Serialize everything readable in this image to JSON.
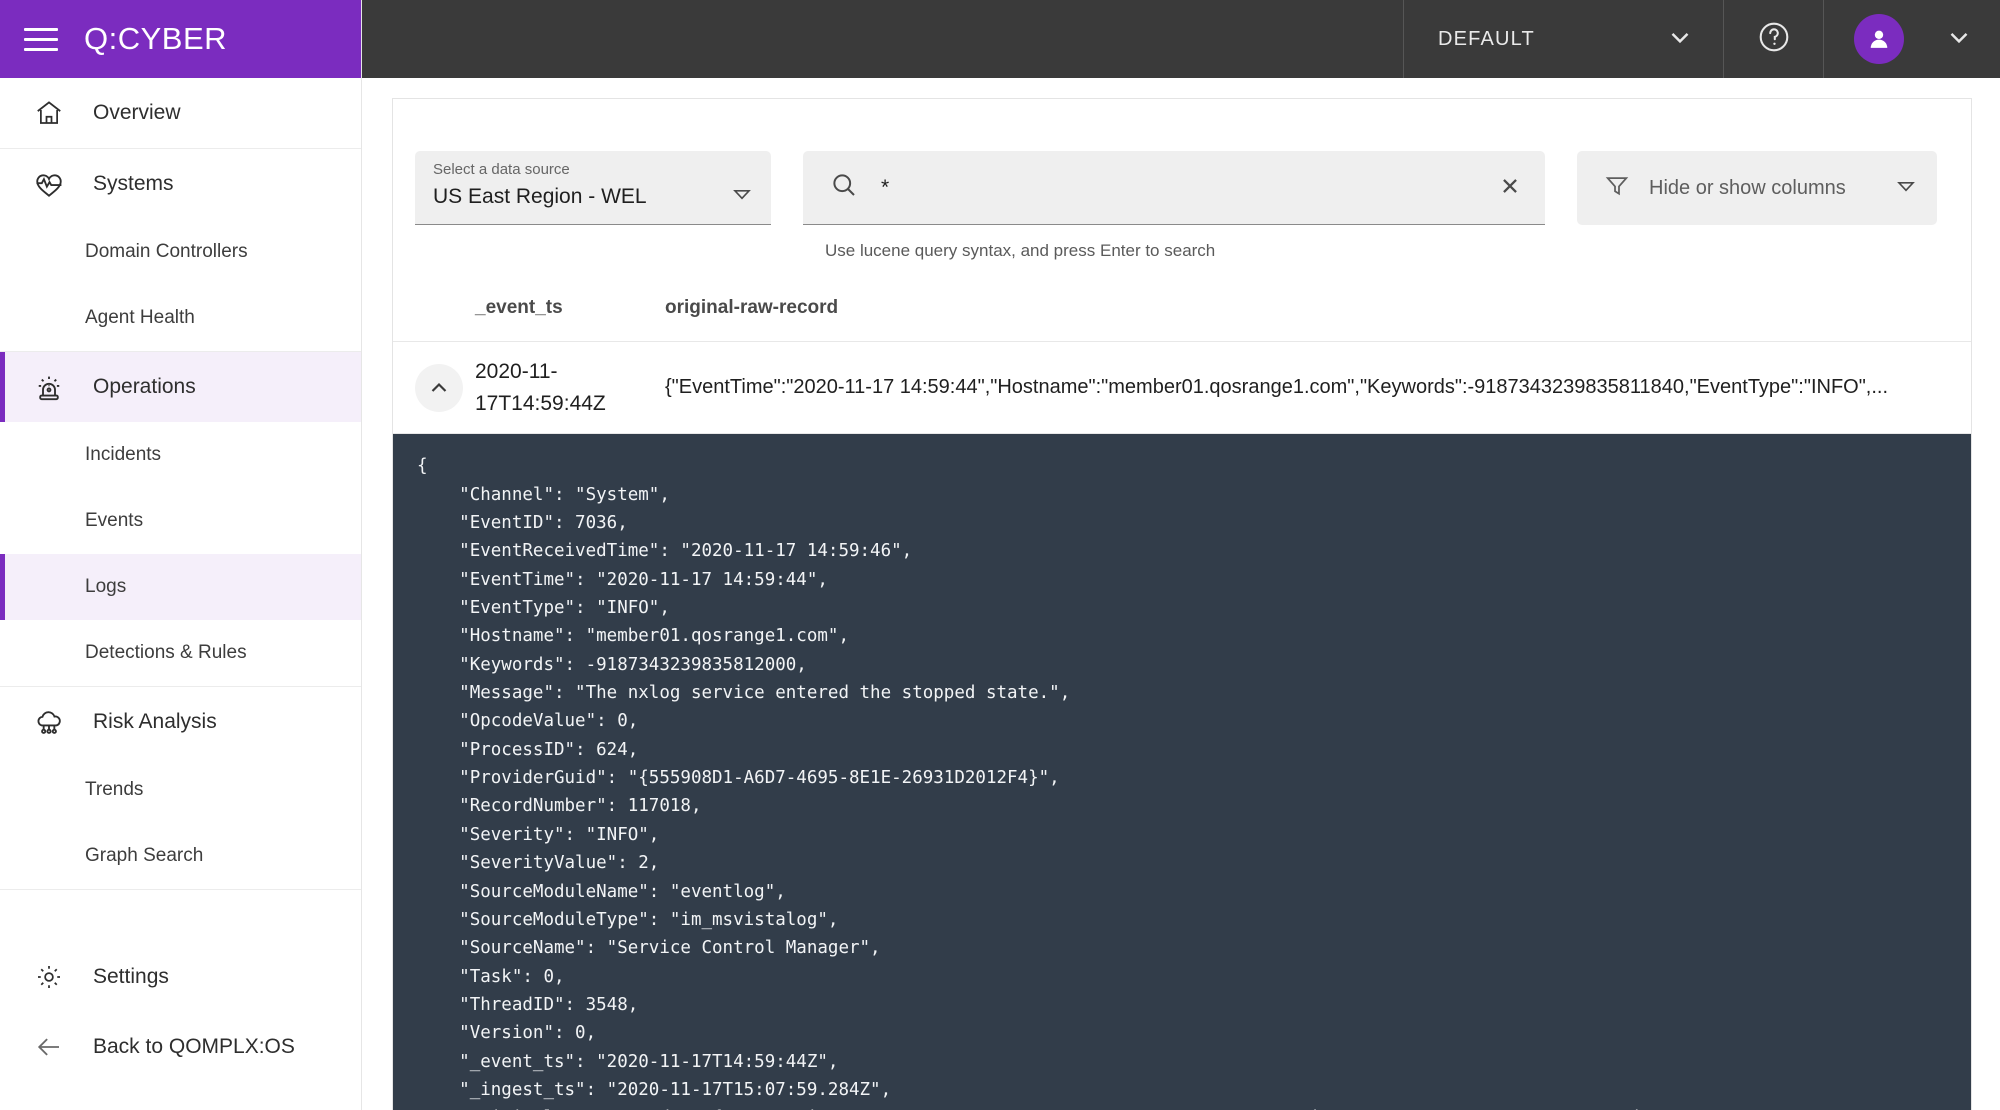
{
  "brand": {
    "title": "Q:CYBER",
    "menu_icon": "hamburger-icon"
  },
  "topbar": {
    "tenant": "DEFAULT",
    "tenant_caret": "chevron-down-icon",
    "help_icon": "help-circle-icon",
    "avatar_icon": "user-avatar-icon",
    "user_caret": "chevron-down-icon"
  },
  "sidebar": {
    "groups": [
      {
        "items": [
          {
            "label": "Overview",
            "icon": "home-icon",
            "type": "item",
            "active": false
          }
        ]
      },
      {
        "items": [
          {
            "label": "Systems",
            "icon": "heartbeat-icon",
            "type": "item",
            "active": false
          },
          {
            "label": "Domain Controllers",
            "type": "sub",
            "active": false
          },
          {
            "label": "Agent Health",
            "type": "sub",
            "active": false
          }
        ]
      },
      {
        "items": [
          {
            "label": "Operations",
            "icon": "siren-icon",
            "type": "item",
            "active": true
          },
          {
            "label": "Incidents",
            "type": "sub",
            "active": false
          },
          {
            "label": "Events",
            "type": "sub",
            "active": false
          },
          {
            "label": "Logs",
            "type": "sub",
            "active": true
          },
          {
            "label": "Detections & Rules",
            "type": "sub",
            "active": false
          }
        ]
      },
      {
        "items": [
          {
            "label": "Risk Analysis",
            "icon": "cloud-network-icon",
            "type": "item",
            "active": false
          },
          {
            "label": "Trends",
            "type": "sub",
            "active": false
          },
          {
            "label": "Graph Search",
            "type": "sub",
            "active": false
          }
        ]
      }
    ],
    "bottom": [
      {
        "label": "Settings",
        "icon": "gear-icon"
      },
      {
        "label": "Back to QOMPLX:OS",
        "icon": "arrow-left-icon"
      }
    ]
  },
  "toolbar": {
    "datasource": {
      "caption": "Select a data source",
      "value": "US East Region - WEL",
      "caret_icon": "caret-down-icon"
    },
    "search": {
      "icon": "search-icon",
      "value": "*",
      "placeholder": "*",
      "clear_icon": "close-icon",
      "hint": "Use lucene query syntax, and press Enter to search"
    },
    "columns": {
      "icon": "filter-icon",
      "label": "Hide or show columns",
      "caret_icon": "caret-down-icon"
    }
  },
  "table": {
    "columns": [
      "_event_ts",
      "original-raw-record"
    ],
    "rows": [
      {
        "expand_icon": "chevron-up-icon",
        "event_ts": "2020-11-17T14:59:44Z",
        "raw_preview": "{\"EventTime\":\"2020-11-17 14:59:44\",\"Hostname\":\"member01.qosrange1.com\",\"Keywords\":-9187343239835811840,\"EventType\":\"INFO\",..."
      }
    ]
  },
  "detail": {
    "json_text": "{\n    \"Channel\": \"System\",\n    \"EventID\": 7036,\n    \"EventReceivedTime\": \"2020-11-17 14:59:46\",\n    \"EventTime\": \"2020-11-17 14:59:44\",\n    \"EventType\": \"INFO\",\n    \"Hostname\": \"member01.qosrange1.com\",\n    \"Keywords\": -9187343239835812000,\n    \"Message\": \"The nxlog service entered the stopped state.\",\n    \"OpcodeValue\": 0,\n    \"ProcessID\": 624,\n    \"ProviderGuid\": \"{555908D1-A6D7-4695-8E1E-26931D2012F4}\",\n    \"RecordNumber\": 117018,\n    \"Severity\": \"INFO\",\n    \"SeverityValue\": 2,\n    \"SourceModuleName\": \"eventlog\",\n    \"SourceModuleType\": \"im_msvistalog\",\n    \"SourceName\": \"Service Control Manager\",\n    \"Task\": 0,\n    \"ThreadID\": 3548,\n    \"Version\": 0,\n    \"_event_ts\": \"2020-11-17T14:59:44Z\",\n    \"_ingest_ts\": \"2020-11-17T15:07:59.284Z\",\n    \"original-raw-record\": \"{\\\"EventTime\\\":\\\"2020-11-17 14:59:44\\\",\\\"Hostname\\\":\\\"member01.qosrange1.com\\\",\\\"Keywords\\\":-9187343239835811840,\\\"EventType\\\":\\\"INFO\\\",\\\"SeverityValue\\\":2,\\\"Severity\\\":\\\"INFO\\\",\\\"EventID\\\":7036,\\\"SourceName\\\":\\\"Service Control Manager\\\",\\\"ProviderGuid\\\":\\\"{555908D1-"
  },
  "colors": {
    "brand_purple": "#7B2CBF",
    "topbar_dark": "#3a3a3a",
    "json_bg": "#323d4a",
    "active_bg": "#f5effa"
  }
}
